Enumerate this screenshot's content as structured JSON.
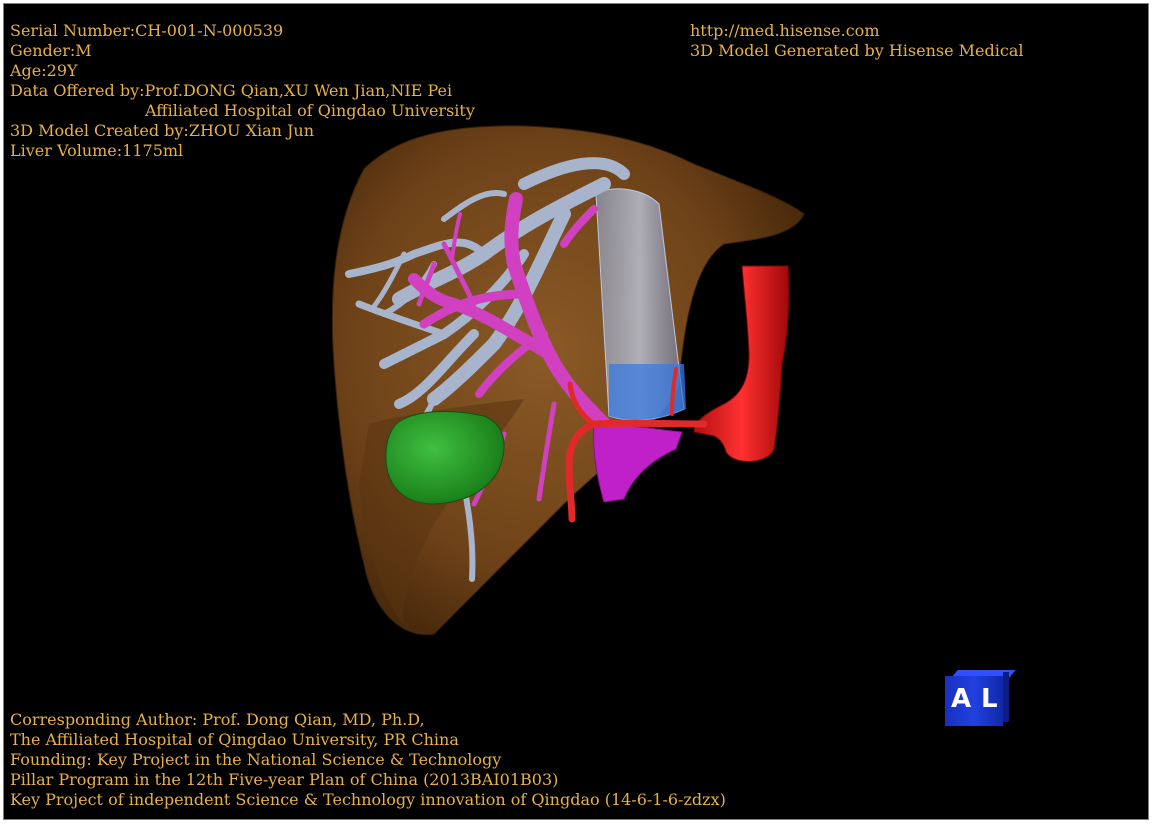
{
  "header_left": {
    "serial": "Serial Number:CH-001-N-000539",
    "gender": "Gender:M",
    "age": "Age:29Y",
    "data_offered": "Data Offered by:Prof.DONG Qian,XU Wen Jian,NIE Pei",
    "hospital": "Affiliated Hospital of Qingdao University",
    "model_created": "3D Model Created by:ZHOU Xian Jun",
    "liver_volume": "Liver Volume:1175ml"
  },
  "header_right": {
    "url": "http://med.hisense.com",
    "generator": "3D Model Generated by Hisense Medical"
  },
  "footer": {
    "line1": "Corresponding Author: Prof. Dong Qian, MD, Ph.D,",
    "line2": "The Affiliated Hospital of Qingdao University, PR China",
    "line3": "Founding: Key Project in the National Science & Technology",
    "line4": "Pillar Program in the 12th Five-year Plan of China (2013BAI01B03)",
    "line5": "Key Project of independent Science & Technology innovation of Qingdao (14-6-1-6-zdzx)"
  },
  "orientation_cube": {
    "left_label": "A",
    "right_label": "L"
  },
  "colors": {
    "text": "#e8b048",
    "liver": "#7a4a1c",
    "hepatic_vein": "#a8b4cc",
    "portal_vein": "#d040c0",
    "artery": "#e02020",
    "gallbladder": "#30a830",
    "ivc": "#7aa8e8"
  }
}
